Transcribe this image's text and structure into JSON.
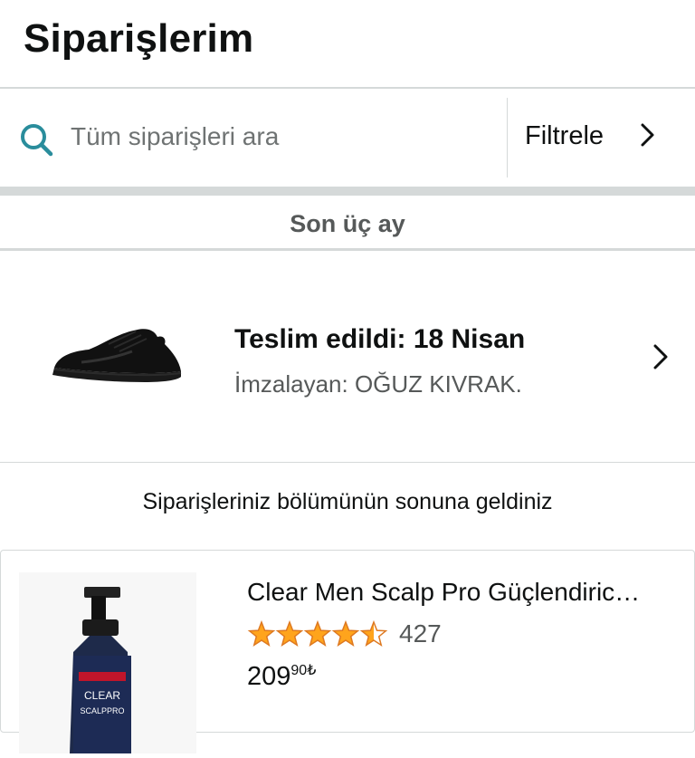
{
  "header": {
    "title": "Siparişlerim"
  },
  "search": {
    "placeholder": "Tüm siparişleri ara"
  },
  "filter": {
    "label": "Filtrele"
  },
  "section": {
    "label": "Son üç ay"
  },
  "order": {
    "status": "Teslim edildi: 18 Nisan",
    "signer": "İmzalayan: OĞUZ KIVRAK.",
    "image_icon": "black-sneaker"
  },
  "end_message": "Siparişleriniz bölümünün sonuna geldiniz",
  "recommendation": {
    "title": "Clear Men Scalp Pro Güçlendiric…",
    "rating": 4.5,
    "rating_count": "427",
    "price_int": "209",
    "price_frac": "90",
    "currency": "₺",
    "image_label": "CLEAR SCALPPRO"
  },
  "colors": {
    "search_icon": "#2a8d9c",
    "star": "#ffa41c",
    "muted_text": "#565959",
    "divider": "#d5d9d9"
  }
}
